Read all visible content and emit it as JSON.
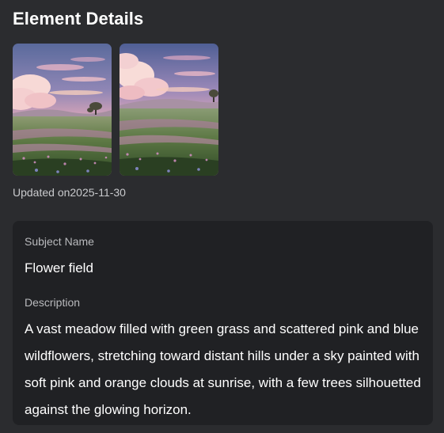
{
  "header": {
    "title": "Element Details"
  },
  "images": [
    {
      "name": "flower-field-image-1"
    },
    {
      "name": "flower-field-image-2"
    }
  ],
  "meta": {
    "updated_text": "Updated on2025-11-30"
  },
  "details": {
    "subject_label": "Subject Name",
    "subject_value": "Flower field",
    "description_label": "Description",
    "description_value": "A vast meadow filled with green grass and scattered pink and blue wildflowers, stretching toward distant hills under a sky painted with soft pink and orange clouds at sunrise, with a few trees silhouetted against the glowing horizon."
  },
  "colors": {
    "background": "#2b2c2f",
    "card": "#202124",
    "text_primary": "#ffffff",
    "text_secondary": "#b9babd"
  }
}
